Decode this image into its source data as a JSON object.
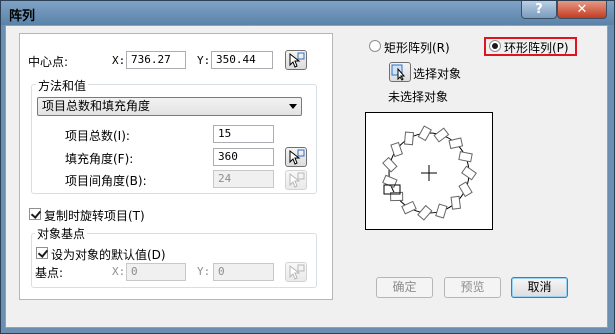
{
  "window": {
    "title": "阵列"
  },
  "titlebar": {
    "help_label": "?",
    "close_label": "✕"
  },
  "center": {
    "label": "中心点:",
    "x_label": "X:",
    "x_value": "736.27",
    "y_label": "Y:",
    "y_value": "350.44"
  },
  "method": {
    "group_label": "方法和值",
    "selected": "项目总数和填充角度",
    "total_label": "项目总数(I):",
    "total_value": "15",
    "fill_label": "填充角度(F):",
    "fill_value": "360",
    "between_label": "项目间角度(B):",
    "between_value": "24"
  },
  "rotate": {
    "label": "复制时旋转项目(T)",
    "checked": true
  },
  "basepoint": {
    "group_label": "对象基点",
    "default_label": "设为对象的默认值(D)",
    "default_checked": true,
    "label": "基点:",
    "x_label": "X:",
    "x_value": "0",
    "y_label": "Y:",
    "y_value": "0"
  },
  "array_type": {
    "rect_label": "矩形阵列(R)",
    "polar_label": "环形阵列(P)",
    "selected": "polar"
  },
  "select_objects": {
    "label": "选择对象",
    "status": "未选择对象"
  },
  "buttons": {
    "ok": "确定",
    "preview": "预览",
    "cancel": "取消"
  },
  "colors": {
    "titlebar": "#6b8fb0",
    "highlight": "#e0141e",
    "close": "#c43c22"
  },
  "icons": {
    "pick": "pick-point-icon",
    "select": "select-objects-icon"
  }
}
